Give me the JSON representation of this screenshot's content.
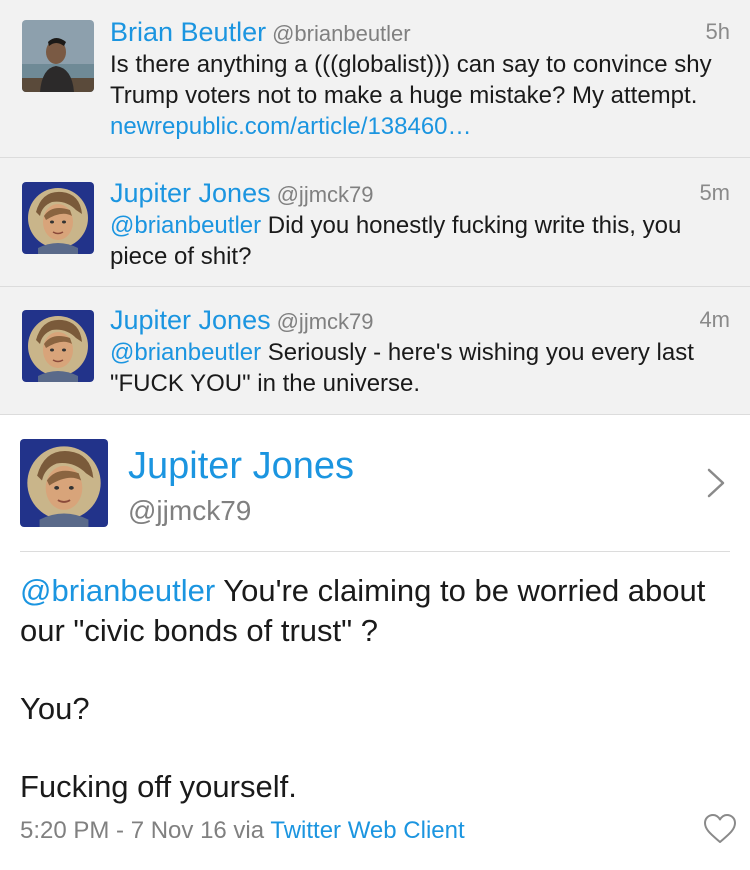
{
  "tweets": [
    {
      "name": "Brian Beutler",
      "handle": "@brianbeutler",
      "time": "5h",
      "mention": "",
      "text": "Is there anything a (((globalist))) can say to convince shy Trump voters not to make a huge mistake? My attempt. ",
      "link": "newrepublic.com/article/138460…"
    },
    {
      "name": "Jupiter Jones",
      "handle": "@jjmck79",
      "time": "5m",
      "mention": "@brianbeutler",
      "text": " Did you honestly fucking write this, you piece of shit?",
      "link": ""
    },
    {
      "name": "Jupiter Jones",
      "handle": "@jjmck79",
      "time": "4m",
      "mention": "@brianbeutler",
      "text": " Seriously -  here's wishing you every last \"FUCK YOU\" in the universe.",
      "link": ""
    }
  ],
  "detail": {
    "name": "Jupiter Jones",
    "handle": "@jjmck79",
    "mention": "@brianbeutler",
    "line1_text": " You're claiming to be worried about our \"civic bonds of trust\" ?",
    "line2_text": "You?",
    "line3_text": "Fucking off yourself.",
    "timestamp": "5:20 PM - 7 Nov 16 via ",
    "client": "Twitter Web Client"
  },
  "colors": {
    "link": "#1b95e0",
    "muted": "#808080",
    "thread_background": "#f2f2f2"
  },
  "icons": [
    "chevron-right-icon",
    "heart-icon"
  ]
}
